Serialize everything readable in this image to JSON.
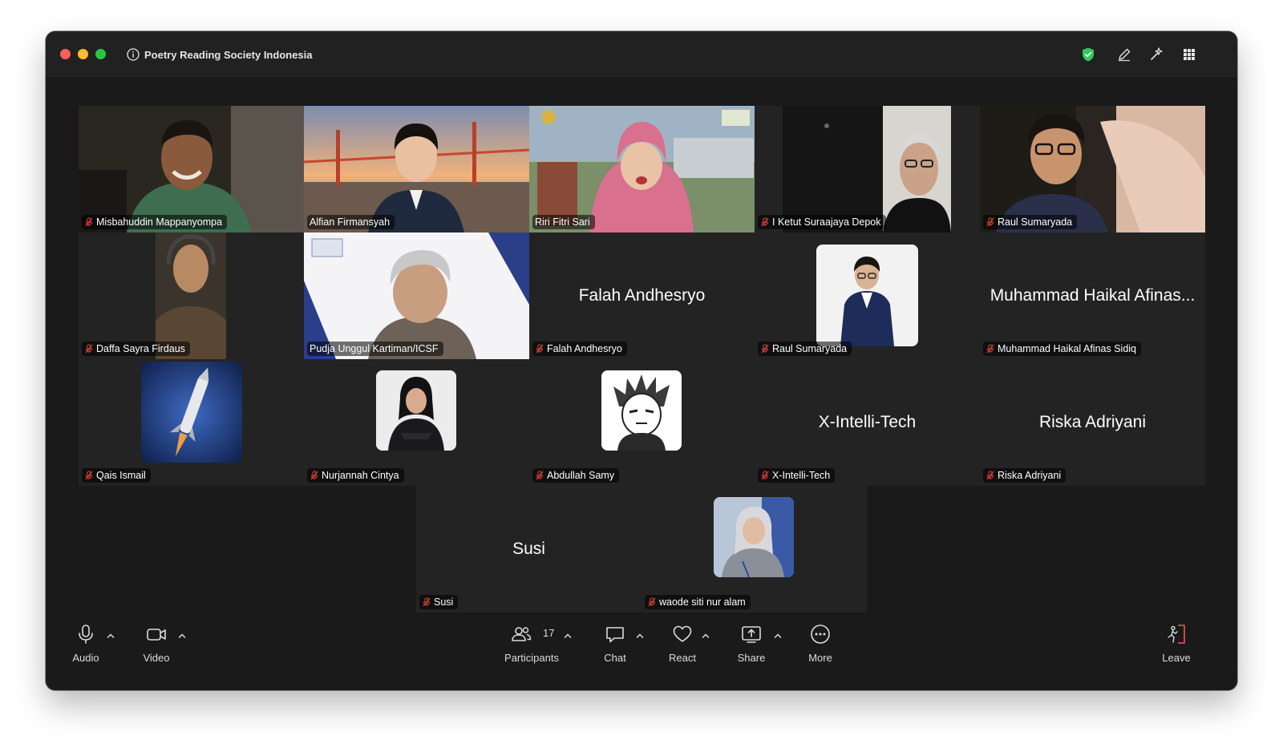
{
  "window": {
    "meeting_title": "Poetry Reading Society Indonesia"
  },
  "colors": {
    "window_bg": "#1a1a1a",
    "tile_bg": "#232323",
    "shield": "#2ec95c",
    "muted_mic": "#e0453a",
    "leave": "#e5484d"
  },
  "titlebar_icons": [
    "info-icon",
    "security-shield-icon",
    "pencil-icon",
    "sparkle-icon",
    "apps-grid-icon"
  ],
  "participants": [
    {
      "name": "Misbahuddin Mappanyompa",
      "muted": true,
      "type": "video"
    },
    {
      "name": "Alfian Firmansyah",
      "muted": false,
      "type": "video"
    },
    {
      "name": "Riri Fitri Sari",
      "muted": false,
      "type": "video"
    },
    {
      "name": "I Ketut Suraajaya Depok",
      "muted": true,
      "type": "video"
    },
    {
      "name": "Raul Sumaryada",
      "muted": true,
      "type": "video"
    },
    {
      "name": "Daffa Sayra Firdaus",
      "muted": true,
      "type": "video"
    },
    {
      "name": "Pudja Unggul Kartiman/ICSF",
      "muted": false,
      "type": "video"
    },
    {
      "name": "Falah Andhesryo",
      "muted": true,
      "type": "name",
      "display": "Falah Andhesryo"
    },
    {
      "name": "Raul Sumaryada",
      "muted": true,
      "type": "avatar"
    },
    {
      "name": "Muhammad Haikal Afinas Sidiq",
      "muted": true,
      "type": "name",
      "display": "Muhammad Haikal Afinas..."
    },
    {
      "name": "Qais Ismail",
      "muted": true,
      "type": "avatar"
    },
    {
      "name": "Nurjannah Cintya",
      "muted": true,
      "type": "avatar"
    },
    {
      "name": "Abdullah Samy",
      "muted": true,
      "type": "avatar"
    },
    {
      "name": "X-Intelli-Tech",
      "muted": true,
      "type": "name",
      "display": "X-Intelli-Tech"
    },
    {
      "name": "Riska Adriyani",
      "muted": true,
      "type": "name",
      "display": "Riska Adriyani"
    },
    {
      "name": "Susi",
      "muted": true,
      "type": "name",
      "display": "Susi"
    },
    {
      "name": "waode siti nur alam",
      "muted": true,
      "type": "avatar"
    }
  ],
  "toolbar": {
    "audio": {
      "label": "Audio",
      "icon": "microphone-icon"
    },
    "video": {
      "label": "Video",
      "icon": "camera-icon"
    },
    "participants": {
      "label": "Participants",
      "icon": "people-icon",
      "count": "17"
    },
    "chat": {
      "label": "Chat",
      "icon": "chat-bubble-icon"
    },
    "react": {
      "label": "React",
      "icon": "heart-icon"
    },
    "share": {
      "label": "Share",
      "icon": "share-screen-icon"
    },
    "more": {
      "label": "More",
      "icon": "more-dots-icon"
    },
    "leave": {
      "label": "Leave",
      "icon": "leave-door-icon"
    }
  }
}
